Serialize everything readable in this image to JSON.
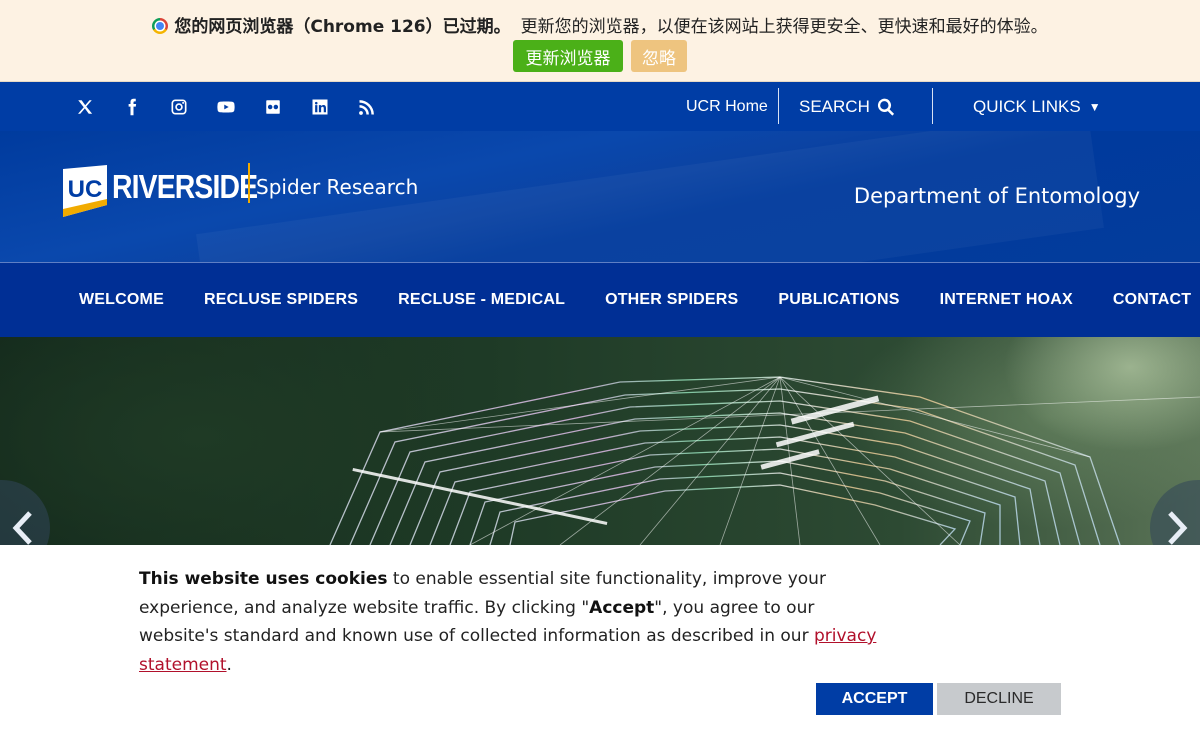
{
  "outdated_browser": {
    "title": "您的网页浏览器（Chrome 126）已过期。",
    "message": "更新您的浏览器，以便在该网站上获得更安全、更快速和最好的体验。",
    "update_label": "更新浏览器",
    "ignore_label": "忽略",
    "icon": "chrome-icon",
    "colors": {
      "background": "#fdf2e3",
      "update": "#4bb018",
      "ignore": "#eec47f"
    }
  },
  "utility": {
    "social": [
      "x-icon",
      "facebook-icon",
      "instagram-icon",
      "youtube-icon",
      "flickr-icon",
      "linkedin-icon",
      "rss-icon"
    ],
    "ucr_home": "UCR Home",
    "search": "SEARCH",
    "quick_links": "QUICK LINKS"
  },
  "brand": {
    "logo_text": "RIVERSIDE",
    "logo_badge": "UC",
    "site_name": "Spider Research",
    "department": "Department of Entomology",
    "colors": {
      "primary": "#003da5",
      "gold": "#f1ab00"
    }
  },
  "nav": {
    "items": [
      "WELCOME",
      "RECLUSE SPIDERS",
      "RECLUSE - MEDICAL",
      "OTHER SPIDERS",
      "PUBLICATIONS",
      "INTERNET HOAX",
      "CONTACT"
    ]
  },
  "hero": {
    "prev_icon": "chevron-left-icon",
    "next_icon": "chevron-right-icon"
  },
  "cookie": {
    "lead": "This website uses cookies",
    "text1": " to enable essential site functionality, improve your experience, and analyze website traffic. By clicking \"",
    "accept_word": "Accept",
    "text2": "\", you agree to our website's standard and known use of collected information as described in our ",
    "privacy_link": "privacy statement",
    "end": ".",
    "accept_label": "ACCEPT",
    "decline_label": "DECLINE"
  }
}
